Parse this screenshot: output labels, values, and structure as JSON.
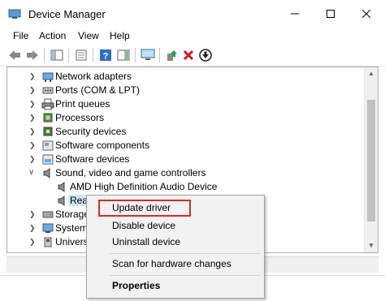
{
  "window": {
    "title": "Device Manager"
  },
  "menu": {
    "items": [
      "File",
      "Action",
      "View",
      "Help"
    ]
  },
  "toolbar": {
    "icons": [
      "back-arrow-icon",
      "forward-arrow-icon",
      "show-hide-tree-icon",
      "properties-icon",
      "help-icon",
      "action-pane-icon",
      "monitor-icon",
      "update-driver-icon",
      "uninstall-icon",
      "disable-icon"
    ]
  },
  "tree": {
    "categories": [
      {
        "label": "Network adapters",
        "icon": "network-adapter-icon"
      },
      {
        "label": "Ports (COM & LPT)",
        "icon": "port-icon"
      },
      {
        "label": "Print queues",
        "icon": "printer-icon"
      },
      {
        "label": "Processors",
        "icon": "processor-icon"
      },
      {
        "label": "Security devices",
        "icon": "security-device-icon"
      },
      {
        "label": "Software components",
        "icon": "software-component-icon"
      },
      {
        "label": "Software devices",
        "icon": "software-device-icon"
      },
      {
        "label": "Sound, video and game controllers",
        "icon": "speaker-icon"
      }
    ],
    "children": [
      {
        "label": "AMD High Definition Audio Device",
        "icon": "speaker-icon"
      },
      {
        "label": "Realtek(R) Audio",
        "icon": "speaker-icon"
      }
    ],
    "after": [
      {
        "label": "Storage controllers",
        "icon": "storage-icon"
      },
      {
        "label": "System devices",
        "icon": "system-device-icon"
      },
      {
        "label": "Universal Serial Bus controllers",
        "icon": "usb-icon"
      }
    ]
  },
  "context_menu": {
    "update": "Update driver",
    "disable": "Disable device",
    "uninstall": "Uninstall device",
    "scan": "Scan for hardware changes",
    "properties": "Properties"
  },
  "colors": {
    "highlight_border": "#d92b2b",
    "selection": "#cce8ff"
  }
}
